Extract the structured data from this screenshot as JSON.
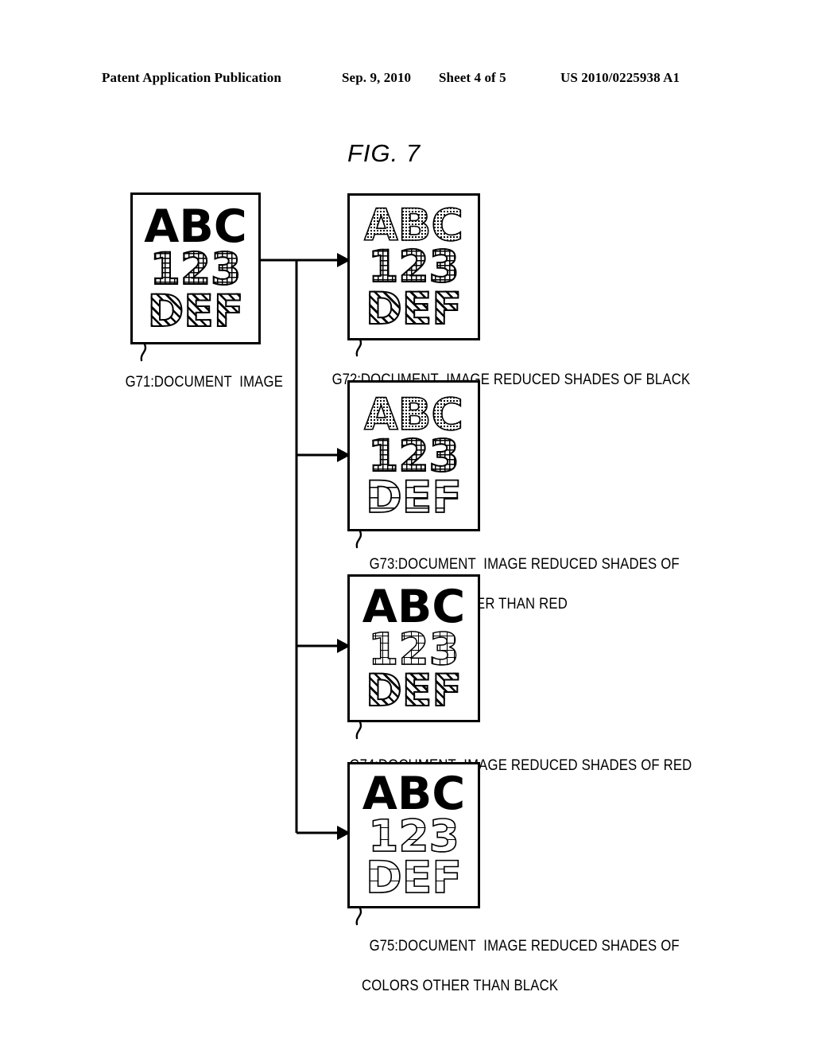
{
  "header": {
    "publication": "Patent Application Publication",
    "date": "Sep. 9, 2010",
    "sheet": "Sheet 4 of 5",
    "number": "US 2010/0225938 A1"
  },
  "figure": {
    "title": "FIG. 7"
  },
  "colors": {
    "ink": "#000000",
    "paper": "#ffffff"
  },
  "diagram": {
    "nodes": [
      {
        "id": "G71",
        "ref": "G71:",
        "caption_line1": "DOCUMENT  IMAGE",
        "caption_line2": "",
        "rows": [
          {
            "text": "ABC",
            "fill": "solid"
          },
          {
            "text": "123",
            "fill": "grid"
          },
          {
            "text": "DEF",
            "fill": "diag"
          }
        ]
      },
      {
        "id": "G72",
        "ref": "G72:",
        "caption_line1": "DOCUMENT  IMAGE REDUCED SHADES OF BLACK",
        "caption_line2": "",
        "rows": [
          {
            "text": "ABC",
            "fill": "dot"
          },
          {
            "text": "123",
            "fill": "grid"
          },
          {
            "text": "DEF",
            "fill": "diag"
          }
        ]
      },
      {
        "id": "G73",
        "ref": "G73:",
        "caption_line1": "DOCUMENT  IMAGE REDUCED SHADES OF",
        "caption_line2": "COLORS OTHER THAN RED",
        "rows": [
          {
            "text": "ABC",
            "fill": "dot"
          },
          {
            "text": "123",
            "fill": "grid"
          },
          {
            "text": "DEF",
            "fill": "outline"
          }
        ]
      },
      {
        "id": "G74",
        "ref": "G74:",
        "caption_line1": "DOCUMENT  IMAGE REDUCED SHADES OF RED",
        "caption_line2": "",
        "rows": [
          {
            "text": "ABC",
            "fill": "solid"
          },
          {
            "text": "123",
            "fill": "lightgrid"
          },
          {
            "text": "DEF",
            "fill": "diag"
          }
        ]
      },
      {
        "id": "G75",
        "ref": "G75:",
        "caption_line1": "DOCUMENT  IMAGE REDUCED SHADES OF",
        "caption_line2": "COLORS OTHER THAN BLACK",
        "rows": [
          {
            "text": "ABC",
            "fill": "solid"
          },
          {
            "text": "123",
            "fill": "lightoutline"
          },
          {
            "text": "DEF",
            "fill": "lightoutline"
          }
        ]
      }
    ]
  }
}
